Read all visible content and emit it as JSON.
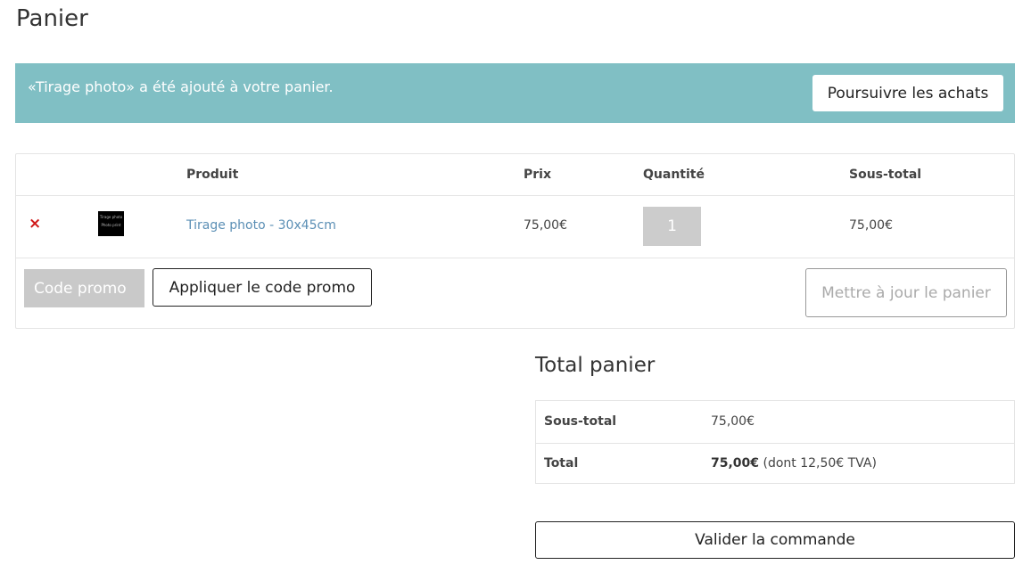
{
  "page": {
    "title": "Panier"
  },
  "notice": {
    "message": "«Tirage photo» a été ajouté à votre panier.",
    "continue_label": "Poursuivre les achats"
  },
  "cart": {
    "headers": {
      "product": "Produit",
      "price": "Prix",
      "quantity": "Quantité",
      "subtotal": "Sous-total"
    },
    "items": [
      {
        "remove_symbol": "×",
        "thumbnail_alt": "Tirage photo",
        "thumbnail_lines": [
          "Tirage photo",
          "Photo print"
        ],
        "name": "Tirage photo - 30x45cm",
        "price": "75,00€",
        "quantity": "1",
        "subtotal": "75,00€"
      }
    ],
    "coupon_placeholder": "Code promo",
    "apply_coupon_label": "Appliquer le code promo",
    "update_cart_label": "Mettre à jour le panier"
  },
  "totals": {
    "title": "Total panier",
    "subtotal_label": "Sous-total",
    "subtotal_value": "75,00€",
    "total_label": "Total",
    "total_value": "75,00€",
    "total_tax_note": "(dont 12,50€ TVA)"
  },
  "checkout_label": "Valider la commande",
  "colors": {
    "notice_bg": "#80bfc4",
    "remove": "#d01818",
    "link": "#5b8fb5",
    "qty_bg": "#cccccc"
  },
  "icons": {
    "remove": "remove-icon",
    "thumbnail": "product-thumbnail"
  }
}
